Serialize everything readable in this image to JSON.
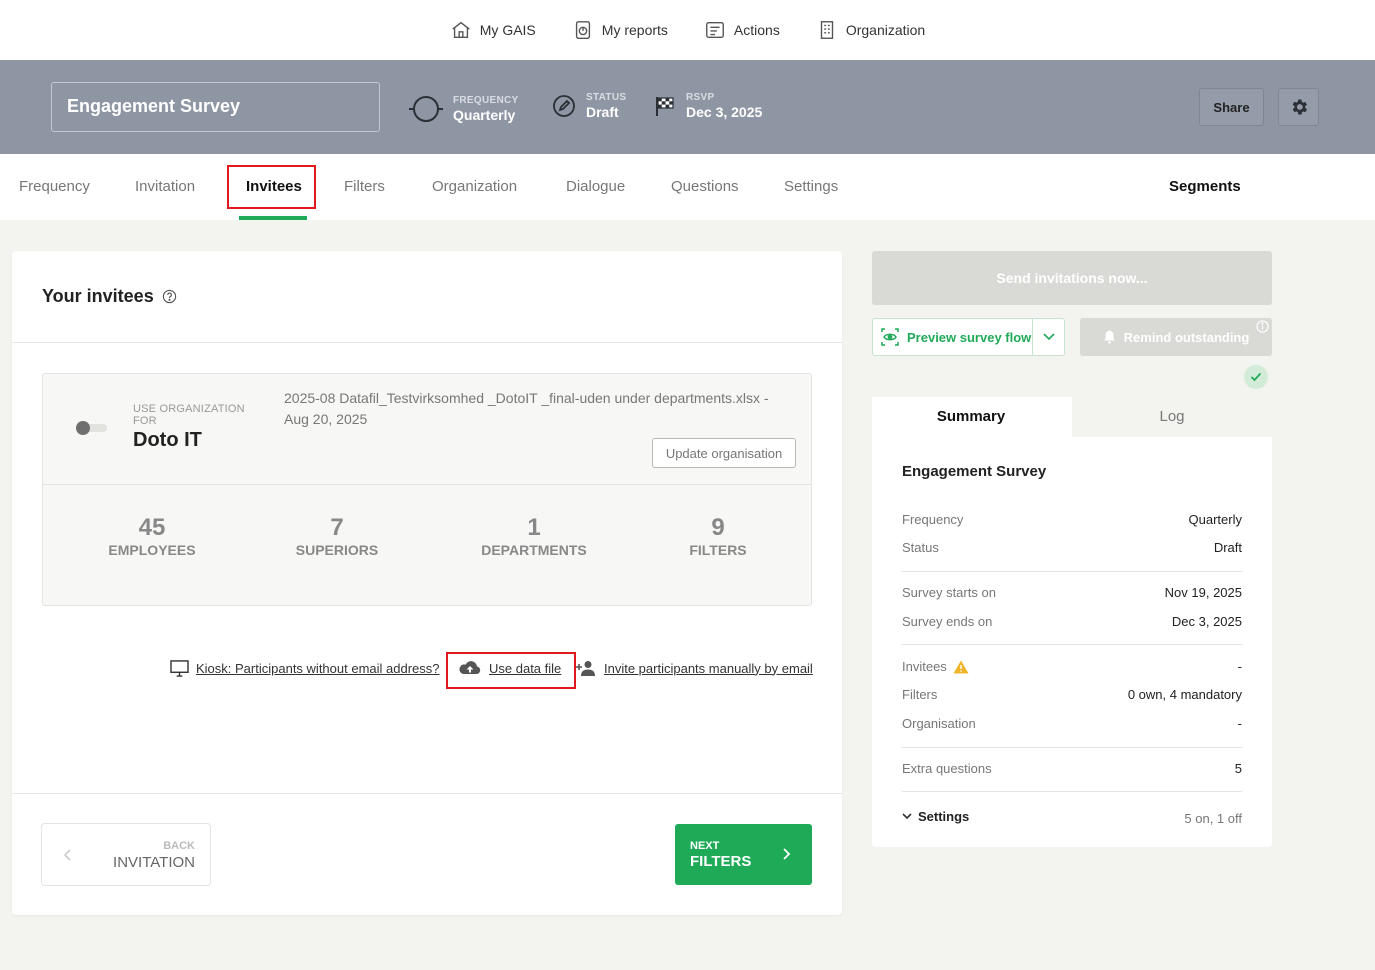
{
  "topnav": {
    "items": [
      {
        "label": "My GAIS",
        "icon": "house-icon"
      },
      {
        "label": "My reports",
        "icon": "report-icon"
      },
      {
        "label": "Actions",
        "icon": "actions-icon"
      },
      {
        "label": "Organization",
        "icon": "building-icon"
      }
    ]
  },
  "header": {
    "survey_title": "Engagement Survey",
    "frequency_label": "FREQUENCY",
    "frequency_value": "Quarterly",
    "status_label": "STATUS",
    "status_value": "Draft",
    "rsvp_label": "RSVP",
    "rsvp_value": "Dec 3, 2025",
    "share_label": "Share"
  },
  "tabs": [
    {
      "label": "Frequency"
    },
    {
      "label": "Invitation"
    },
    {
      "label": "Invitees",
      "active": true
    },
    {
      "label": "Filters"
    },
    {
      "label": "Organization"
    },
    {
      "label": "Dialogue"
    },
    {
      "label": "Questions"
    },
    {
      "label": "Settings"
    },
    {
      "label": "Segments"
    }
  ],
  "invitees": {
    "title": "Your invitees",
    "org_label": "USE ORGANIZATION FOR",
    "org_name": "Doto IT",
    "file_text": "2025-08 Datafil_Testvirksomhed _DotoIT _final-uden under departments.xlsx - Aug 20, 2025",
    "update_label": "Update organisation",
    "stats": [
      {
        "num": "45",
        "cap": "EMPLOYEES"
      },
      {
        "num": "7",
        "cap": "SUPERIORS"
      },
      {
        "num": "1",
        "cap": "DEPARTMENTS"
      },
      {
        "num": "9",
        "cap": "FILTERS"
      }
    ],
    "kiosk_link": "Kiosk: Participants without email address?",
    "datafile_link": "Use data file",
    "manual_link": "Invite participants manually by email",
    "back_small": "BACK",
    "back_big": "INVITATION",
    "next_small": "NEXT",
    "next_big": "FILTERS"
  },
  "right": {
    "send_label": "Send invitations now...",
    "preview_label": "Preview survey flow",
    "remind_label": "Remind outstanding",
    "tab_summary": "Summary",
    "tab_log": "Log",
    "summary_title": "Engagement Survey",
    "rows": [
      {
        "k": "Frequency",
        "v": "Quarterly"
      },
      {
        "k": "Status",
        "v": "Draft"
      },
      {
        "k": "Survey starts on",
        "v": "Nov 19, 2025"
      },
      {
        "k": "Survey ends on",
        "v": "Dec 3, 2025"
      },
      {
        "k": "Invitees",
        "v": "-"
      },
      {
        "k": "Filters",
        "v": "0 own, 4 mandatory"
      },
      {
        "k": "Organisation",
        "v": "-"
      },
      {
        "k": "Extra questions",
        "v": "5"
      },
      {
        "k": "Settings",
        "v": "5 on, 1 off"
      }
    ]
  },
  "colors": {
    "accent": "#1faa57",
    "band": "#8e96a4",
    "highlight": "#e0191f",
    "warning": "#f0b429"
  }
}
